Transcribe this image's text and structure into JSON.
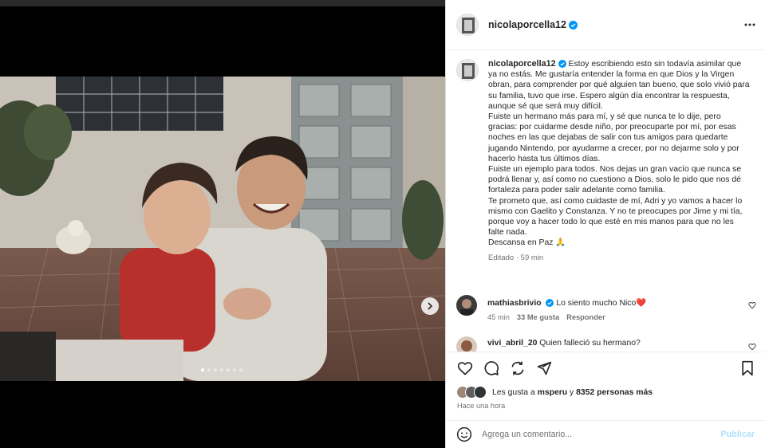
{
  "post": {
    "username": "nicolaporcella12",
    "verified": true,
    "caption": {
      "username": "nicolaporcella12",
      "text": " Estoy escribiendo esto sin todavía asimilar que ya no estás. Me gustaría entender la forma en que Dios y la Virgen obran, para comprender por qué alguien tan bueno, que solo vivió para su familia, tuvo que irse. Espero algún día encontrar la respuesta, aunque sé que será muy difícil.\nFuiste un hermano más para mí, y sé que nunca te lo dije, pero gracias: por cuidarme desde niño, por preocuparte por mí, por esas noches en las que dejabas de salir con tus amigos para quedarte jugando Nintendo, por ayudarme a crecer, por no dejarme solo y por hacerlo hasta tus últimos días.\nFuiste un ejemplo para todos. Nos dejas un gran vacío que nunca se podrá llenar y, así como no cuestiono a Dios, solo le pido que nos dé fortaleza para poder salir adelante como familia.\nTe prometo que, así como cuidaste de mí, Adri y yo vamos a hacer lo mismo con Gaelito y Constanza. Y no te preocupes por Jime y mi tía, porque voy a hacer todo lo que esté en mis manos para que no les falte nada.\nDescansa en Paz 🙏",
      "meta": "Editado · 59 min"
    },
    "carousel": {
      "total_slides": 7,
      "active_index": 0
    }
  },
  "comments": [
    {
      "username": "mathiasbrivio",
      "verified": true,
      "text": "Lo siento mucho Nico",
      "emoji": "❤️",
      "time": "45 min",
      "likes": "33 Me gusta",
      "reply": "Responder"
    },
    {
      "username": "vivi_abril_20",
      "verified": false,
      "text": "Quien falleció su hermano?",
      "time": "",
      "likes": "",
      "reply": ""
    }
  ],
  "likes": {
    "prefix": "Les gusta a ",
    "first_user": "msperu",
    "middle": " y ",
    "count": "8352 personas más"
  },
  "posted_ago": "Hace una hora",
  "composer": {
    "placeholder": "Agrega un comentario...",
    "publish_label": "Publicar"
  },
  "icons": {
    "like": "heart-icon",
    "comment": "comment-icon",
    "share": "share-icon",
    "send": "paper-plane-icon",
    "save": "bookmark-icon",
    "more": "more-icon",
    "emoji": "emoji-icon",
    "next": "chevron-right-icon"
  },
  "colors": {
    "verified_blue": "#0095f6",
    "publish_disabled": "#b2dffc",
    "heart_red": "#ff3040"
  }
}
